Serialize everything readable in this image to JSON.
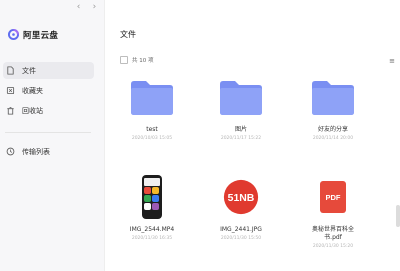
{
  "nav": {
    "back": "‹",
    "forward": "›"
  },
  "app": {
    "name": "阿里云盘"
  },
  "sidebar": {
    "items": [
      {
        "label": "文件",
        "icon": "file-icon",
        "active": true
      },
      {
        "label": "收藏夹",
        "icon": "star-icon",
        "active": false
      },
      {
        "label": "回收站",
        "icon": "trash-icon",
        "active": false
      },
      {
        "label": "传输列表",
        "icon": "transfer-icon",
        "active": false
      }
    ]
  },
  "main": {
    "title": "文件",
    "count_label": "共 10 项",
    "sort_icon": "≡",
    "files": [
      {
        "name": "test",
        "date": "2020/10/03 15:05",
        "type": "folder"
      },
      {
        "name": "图片",
        "date": "2020/11/17 15:22",
        "type": "folder"
      },
      {
        "name": "好友的分享",
        "date": "2020/11/14 20:00",
        "type": "folder"
      },
      {
        "name": "IMG_2544.MP4",
        "date": "2020/11/30 16:35",
        "type": "video"
      },
      {
        "name": "IMG_2441.JPG",
        "date": "2020/11/30 15:50",
        "type": "image",
        "badge_text": "51NB"
      },
      {
        "name": "奥秘世界百科全书.pdf",
        "date": "2020/11/30 15:20",
        "type": "pdf",
        "badge_text": "PDF"
      }
    ]
  },
  "colors": {
    "folder": "#8ea2f7",
    "folder_dark": "#7a8ff2",
    "accent_red": "#e03a2f",
    "pdf": "#e64a3b"
  }
}
